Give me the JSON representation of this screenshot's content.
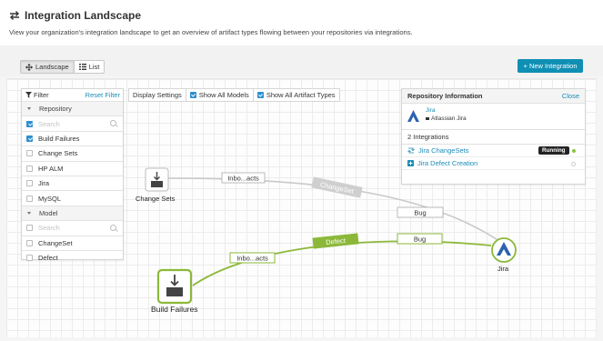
{
  "header": {
    "title": "Integration Landscape",
    "subtitle": "View your organization's integration landscape to get an overview of artifact types flowing between your repositories via integrations."
  },
  "toolbar": {
    "landscape_label": "Landscape",
    "list_label": "List",
    "new_integration_label": "+ New Integration"
  },
  "filter": {
    "title": "Filter",
    "reset_label": "Reset Filter",
    "repository_group": "Repository",
    "model_group": "Model",
    "search_placeholder": "Search",
    "repositories": [
      {
        "label": "Build Failures",
        "checked": true
      },
      {
        "label": "Change Sets",
        "checked": false
      },
      {
        "label": "HP ALM",
        "checked": false
      },
      {
        "label": "Jira",
        "checked": false
      },
      {
        "label": "MySQL",
        "checked": false
      }
    ],
    "models": [
      {
        "label": "ChangeSet",
        "checked": false
      },
      {
        "label": "Defect",
        "checked": false
      }
    ]
  },
  "display": {
    "settings_label": "Display Settings",
    "show_all_models": "Show All Models",
    "show_all_artifact_types": "Show All Artifact Types"
  },
  "repo_info": {
    "title": "Repository Information",
    "close_label": "Close",
    "repo_name": "Jira",
    "repo_type": "Atlassian Jira",
    "integrations_count": "2 Integrations",
    "integrations": [
      {
        "label": "Jira ChangeSets",
        "status": "Running"
      },
      {
        "label": "Jira Defect Creation",
        "status": ""
      }
    ]
  },
  "graph": {
    "nodes": {
      "change_sets": "Change Sets",
      "build_failures": "Build Failures",
      "jira": "Jira"
    },
    "edges": {
      "top_inbound": "Inbo...acts",
      "top_model": "ChangeSet",
      "top_outbound": "Bug",
      "bottom_inbound": "Inbo...acts",
      "bottom_model": "Defect",
      "bottom_outbound": "Bug"
    }
  },
  "colors": {
    "accent": "#0f8fb4",
    "green": "#8cb83a",
    "grey_edge": "#c9c9c9",
    "jira_blue": "#2d62b0"
  }
}
